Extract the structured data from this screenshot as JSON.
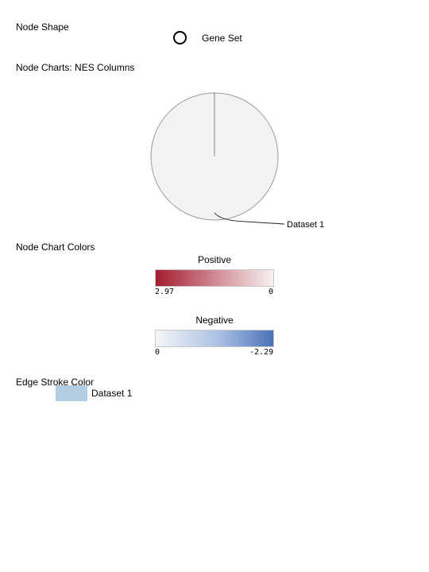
{
  "sections": {
    "node_shape": "Node Shape",
    "node_charts": "Node Charts: NES Columns",
    "node_chart_colors": "Node Chart Colors",
    "edge_stroke_color": "Edge Stroke Color"
  },
  "node_shape": {
    "icon": "circle-outline-icon",
    "label": "Gene Set"
  },
  "node_chart": {
    "dataset_label": "Dataset 1"
  },
  "chart_colors": {
    "positive": {
      "heading": "Positive",
      "min_label": "2.97",
      "max_label": "0",
      "color_start": "#a31c2f",
      "color_end": "#f6f1f1"
    },
    "negative": {
      "heading": "Negative",
      "min_label": "0",
      "max_label": "-2.29",
      "color_start": "#f5f5f7",
      "color_end": "#4a72b8"
    }
  },
  "edge": {
    "swatch_color": "#b3cde3",
    "label": "Dataset 1"
  }
}
